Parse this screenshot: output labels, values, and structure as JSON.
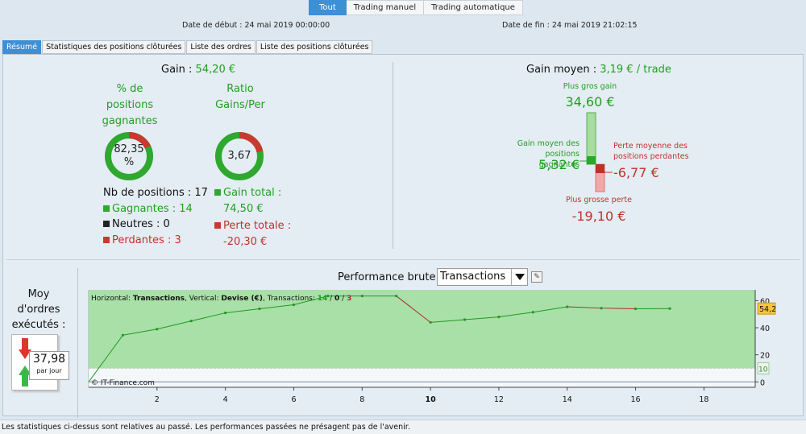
{
  "top_tabs": [
    {
      "label": "Tout",
      "active": true
    },
    {
      "label": "Trading manuel",
      "active": false
    },
    {
      "label": "Trading automatique",
      "active": false
    }
  ],
  "dates": {
    "start": "Date de début : 24 mai 2019 00:00:00",
    "end": "Date de fin : 24 mai 2019 21:02:15"
  },
  "sub_tabs": [
    {
      "label": "Résumé",
      "active": true
    },
    {
      "label": "Statistiques des positions clôturées",
      "active": false
    },
    {
      "label": "Liste des ordres",
      "active": false
    },
    {
      "label": "Liste des positions clôturées",
      "active": false
    }
  ],
  "gain": {
    "label": "Gain :",
    "value": "54,20 €"
  },
  "pct_winning": {
    "title_line1": "% de",
    "title_line2": "positions",
    "title_line3": "gagnantes",
    "value_line1": "82,35",
    "value_line2": "%",
    "fraction": 0.8235
  },
  "ratio": {
    "title_line1": "Ratio",
    "title_line2": "Gains/Per",
    "value": "3,67",
    "fraction": 0.786
  },
  "positions": {
    "count": "Nb de positions : 17",
    "winning": "Gagnantes : 14",
    "neutral": "Neutres : 0",
    "losing": "Perdantes : 3"
  },
  "totals": {
    "gain_label": "Gain total :",
    "gain_value": "74,50 €",
    "loss_label": "Perte totale :",
    "loss_value": "-20,30 €"
  },
  "avg_gain": {
    "label": "Gain moyen :",
    "value": "3,19 € / trade"
  },
  "box": {
    "biggest_gain_label": "Plus gros gain",
    "biggest_gain_value": "34,60 €",
    "avg_win_label_1": "Gain moyen des positions",
    "avg_win_label_2": "gagnantes",
    "avg_win_value": "5,32 €",
    "avg_loss_label_1": "Perte moyenne des",
    "avg_loss_label_2": "positions perdantes",
    "avg_loss_value": "-6,77 €",
    "biggest_loss_label": "Plus grosse perte",
    "biggest_loss_value": "-19,10 €"
  },
  "performance": {
    "title": "Performance brute",
    "select_value": "Transactions"
  },
  "orders": {
    "label_line1": "Moy",
    "label_line2": "d'ordres",
    "label_line3": "exécutés :",
    "value": "37,98",
    "unit": "par jour"
  },
  "chart_data": {
    "type": "line",
    "header_prefix": "Horizontal: ",
    "header_h": "Transactions",
    "header_mid": ", Vertical: ",
    "header_v": "Devise (€)",
    "header_tr": ", Transactions: ",
    "header_w": "14",
    "header_n": "0",
    "header_l": "3",
    "header_sep": " / ",
    "copyright": "© IT-Finance.com",
    "x": [
      0,
      1,
      2,
      3,
      4,
      5,
      6,
      7,
      8,
      9,
      10,
      11,
      12,
      13,
      14,
      15,
      16,
      17
    ],
    "y": [
      0,
      34.5,
      39,
      45,
      51,
      54,
      57,
      63.5,
      63.5,
      63.5,
      44,
      46,
      48,
      51.5,
      55.5,
      54.5,
      54,
      54.2
    ],
    "segment_colors": [
      "win",
      "win",
      "win",
      "win",
      "win",
      "win",
      "win",
      "win",
      "win",
      "loss",
      "win",
      "win",
      "win",
      "win",
      "loss",
      "loss",
      "win"
    ],
    "colors": {
      "win": "#1f9a1f",
      "loss": "#b02a2a",
      "area": "#a8e0a8",
      "threshold": "#b8d8a8"
    },
    "xlim": [
      0,
      19.5
    ],
    "ylim": [
      -4,
      68
    ],
    "xticks": [
      2,
      4,
      6,
      8,
      10,
      12,
      14,
      16,
      18
    ],
    "yticks": [
      0,
      20,
      40,
      60
    ],
    "last_value_label": "54,2",
    "threshold_value": 10,
    "threshold_label": "10"
  },
  "footer": "Les statistiques ci-dessus sont relatives au passé. Les performances passées ne présagent pas de l'avenir."
}
